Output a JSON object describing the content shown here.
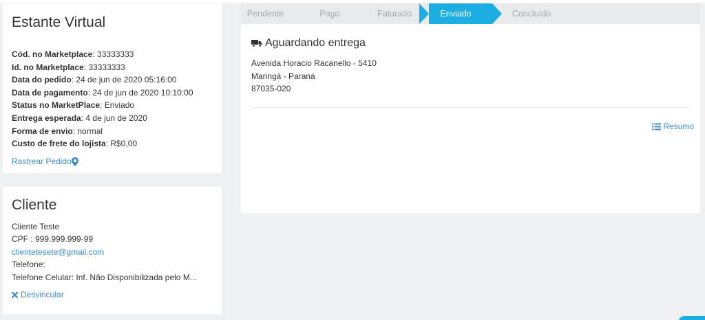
{
  "store": {
    "title": "Estante Virtual",
    "fields": [
      {
        "label": "Cód. no Marketplace",
        "value": "33333333"
      },
      {
        "label": "Id. no Marketplace",
        "value": "33333333"
      },
      {
        "label": "Data do pedido",
        "value": "24 de jun de 2020 05:16:00"
      },
      {
        "label": "Data de pagamento",
        "value": "24 de jun de 2020 10:10:00"
      },
      {
        "label": "Status no MarketPlace",
        "value": "Enviado"
      },
      {
        "label": "Entrega esperada",
        "value": "4 de jun de 2020"
      },
      {
        "label": "Forma de envio",
        "value": "normal"
      },
      {
        "label": "Custo de frete do lojista",
        "value": "R$0,00"
      }
    ],
    "track_link": "Rastrear Pedido",
    "track_icon": "map-marker-icon"
  },
  "client": {
    "title": "Cliente",
    "name": "Cliente Teste",
    "cpf": "CPF : 999.999.999-99",
    "email": "clientetesete@gmail.com",
    "phone": "Telefone:",
    "mobile": "Telefone Celular: Inf. Não Disponibilizada pelo M...",
    "unlink_label": "Desvincular",
    "unlink_icon": "x-icon"
  },
  "steps": [
    {
      "label": "Pendente",
      "active": false
    },
    {
      "label": "Pago",
      "active": false
    },
    {
      "label": "Faturado",
      "active": false
    },
    {
      "label": "Enviado",
      "active": true
    },
    {
      "label": "Concluído",
      "active": false
    }
  ],
  "delivery": {
    "title": "Aguardando entrega",
    "icon": "truck-icon",
    "address_lines": [
      "Avenida Horacio Racanello - 5410",
      "Maringá - Paraná",
      "87035-020"
    ],
    "summary_label": "Resumo",
    "summary_icon": "list-icon"
  },
  "colors": {
    "accent": "#1aaee2",
    "link": "#3a8cc6",
    "background": "#eef0f1"
  }
}
